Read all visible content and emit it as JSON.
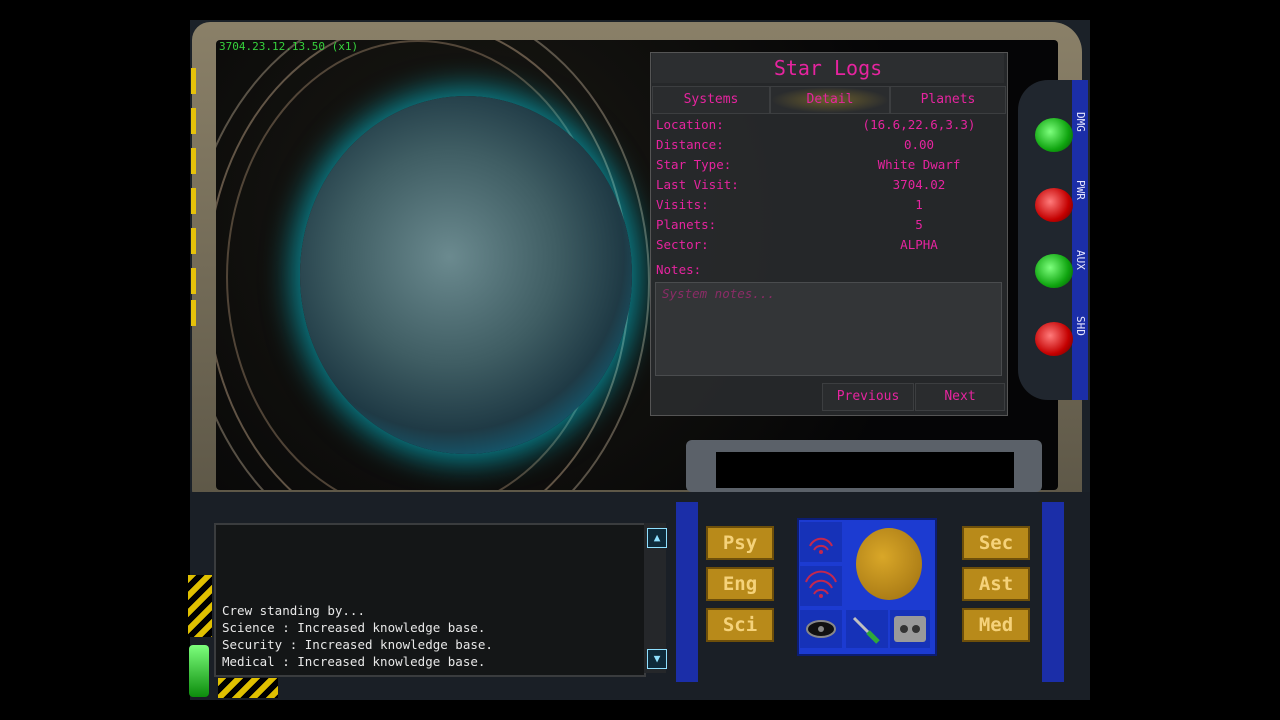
{
  "viewport": {
    "timestamp": "3704.23.12.13.50 (x1)"
  },
  "star_logs": {
    "title": "Star Logs",
    "tabs": [
      {
        "label": "Systems",
        "active": false
      },
      {
        "label": "Detail",
        "active": true
      },
      {
        "label": "Planets",
        "active": false
      }
    ],
    "fields": [
      {
        "label": "Location:",
        "value": "(16.6,22.6,3.3)"
      },
      {
        "label": "Distance:",
        "value": "0.00"
      },
      {
        "label": "Star Type:",
        "value": "White Dwarf"
      },
      {
        "label": "Last Visit:",
        "value": "3704.02"
      },
      {
        "label": "Visits:",
        "value": "1"
      },
      {
        "label": "Planets:",
        "value": "5"
      },
      {
        "label": "Sector:",
        "value": "ALPHA"
      }
    ],
    "notes_label": "Notes:",
    "notes_placeholder": "System notes...",
    "previous_label": "Previous",
    "next_label": "Next"
  },
  "side_strip": {
    "labels": [
      "DMG",
      "PWR",
      "AUX",
      "SHD"
    ]
  },
  "messages": [
    "Crew standing by...",
    "Science : Increased knowledge base.",
    "Security : Increased knowledge base.",
    "Medical : Increased knowledge base."
  ],
  "crew_buttons_left": [
    "Psy",
    "Eng",
    "Sci"
  ],
  "crew_buttons_right": [
    "Sec",
    "Ast",
    "Med"
  ],
  "colors": {
    "accent": "#e6249f",
    "timestamp": "#36d23c",
    "console_button": "#b88a1a"
  }
}
